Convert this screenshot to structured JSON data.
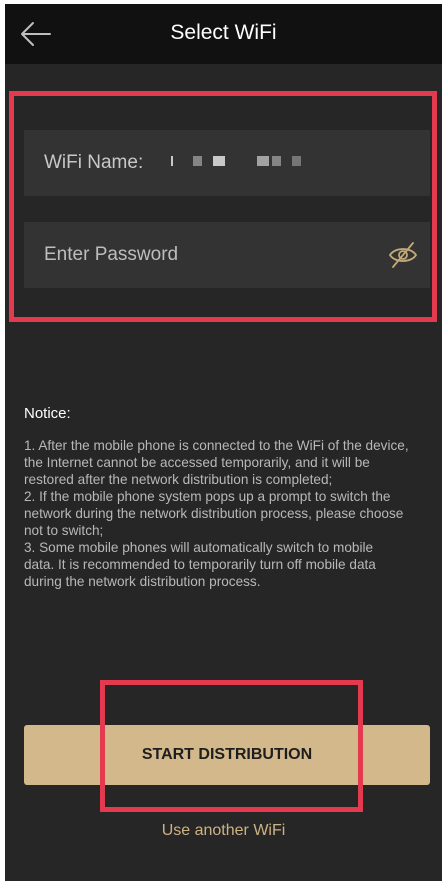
{
  "header": {
    "title": "Select WiFi",
    "back_icon": "arrow-left-icon"
  },
  "form": {
    "wifi_name_label": "WiFi Name:",
    "password_placeholder": "Enter Password",
    "visibility_icon": "eye-slash-icon"
  },
  "notice": {
    "title": "Notice:",
    "lines": [
      "1. After the mobile phone is connected to the WiFi of the device,",
      "the Internet cannot be accessed temporarily, and it will be",
      "restored after the network distribution is completed;",
      "2. If the mobile phone system pops up a prompt to switch the",
      "network during the network distribution process, please choose",
      "not to switch;",
      "3. Some mobile phones will automatically switch to mobile",
      "data. It is recommended to temporarily turn off mobile data",
      "during the network distribution process."
    ]
  },
  "actions": {
    "start_label": "START DISTRIBUTION",
    "alt_label": "Use another WiFi"
  },
  "colors": {
    "background": "#262626",
    "header": "#111111",
    "field": "#333333",
    "accent": "#d2b88a",
    "highlight": "#e33a4f"
  }
}
